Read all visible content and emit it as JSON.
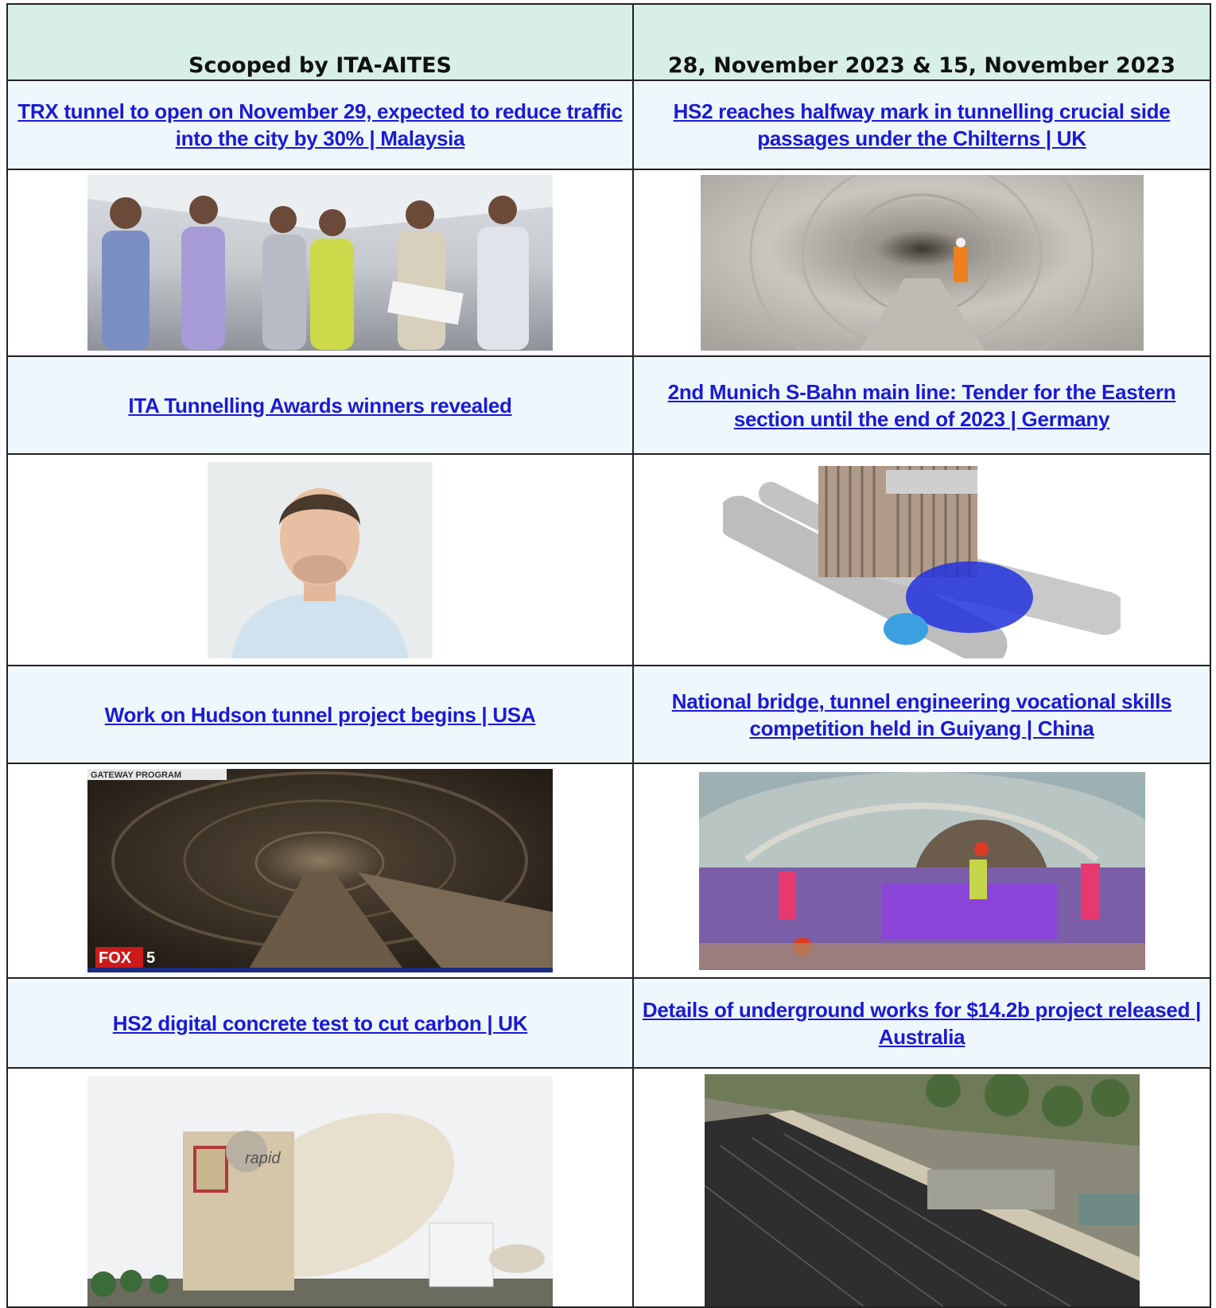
{
  "header": {
    "left": "Scooped by ITA-AITES",
    "right": "28, November 2023  &  15, November 2023"
  },
  "rows": [
    {
      "left_title": "TRX tunnel to open on November 29, expected to reduce traffic into the city by 30% | Malaysia",
      "right_title": "HS2 reaches halfway mark in tunnelling crucial side passages under the Chilterns | UK"
    },
    {
      "left_title": "ITA Tunnelling Awards winners revealed",
      "right_title": "2nd Munich S-Bahn main line: Tender for the Eastern section until the end of 2023 | Germany"
    },
    {
      "left_title": "Work on Hudson tunnel project begins | USA",
      "right_title": "National bridge, tunnel engineering vocational skills competition held in Guiyang | China"
    },
    {
      "left_title": "HS2 digital concrete test to cut carbon | UK",
      "right_title": "Details of underground works for $14.2b project released | Australia"
    }
  ],
  "images": {
    "gateway_caption": "GATEWAY PROGRAM",
    "fox_logo": "FOX",
    "fox_number": "5",
    "mixer_brand": "rapid"
  }
}
